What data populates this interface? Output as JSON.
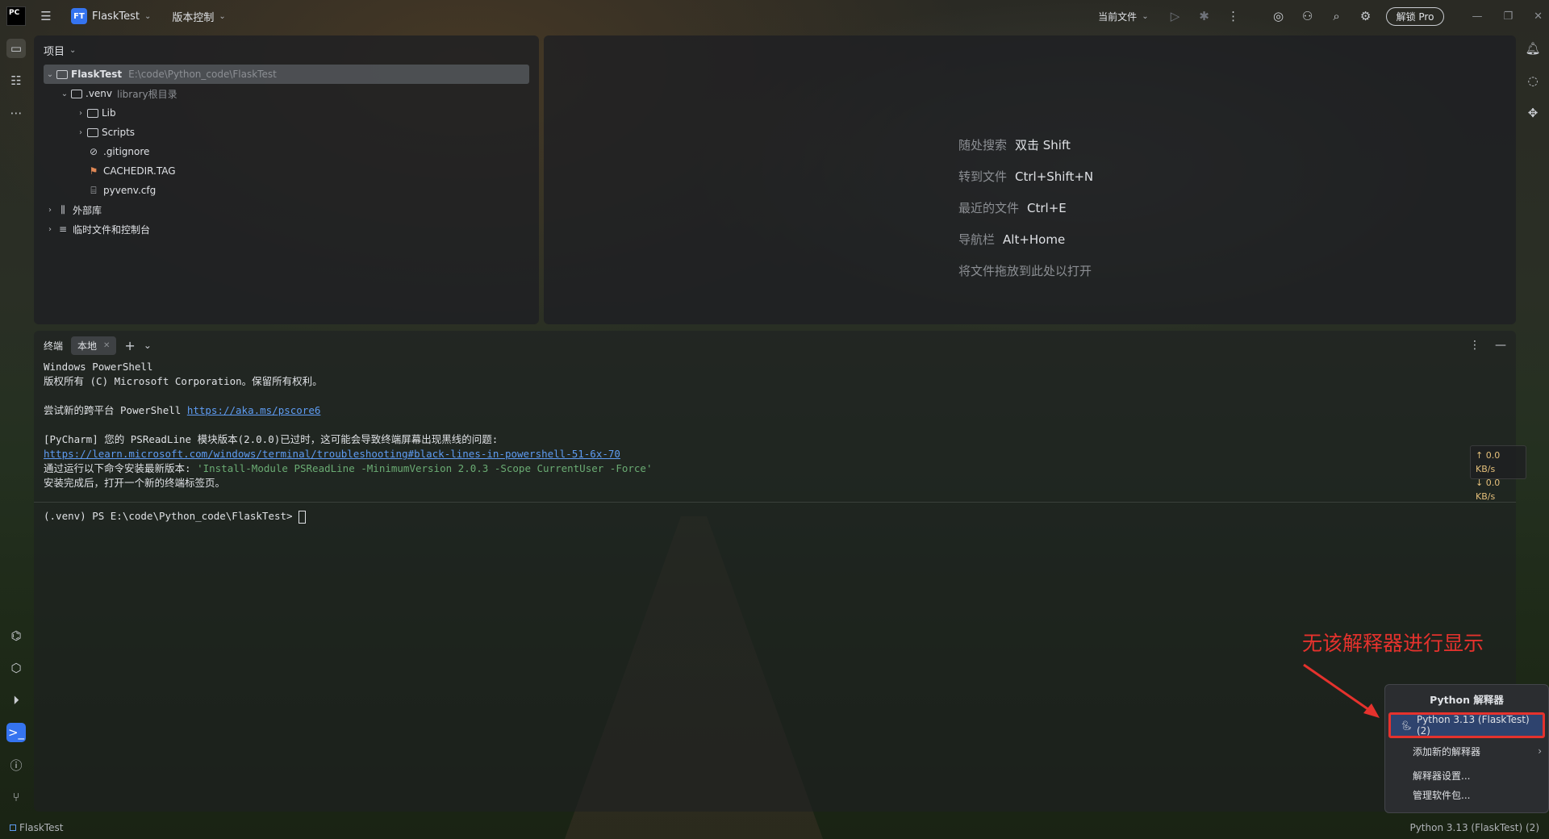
{
  "titlebar": {
    "app_logo": "PC",
    "project_badge": "FT",
    "project_name": "FlaskTest",
    "vcs_label": "版本控制",
    "run_config": "当前文件",
    "unlock_pro": "解锁 Pro"
  },
  "project_panel": {
    "title": "项目",
    "tree": [
      {
        "name": "FlaskTest",
        "hint": "E:\\code\\Python_code\\FlaskTest"
      },
      {
        "name": ".venv",
        "hint": "library根目录"
      },
      {
        "name": "Lib"
      },
      {
        "name": "Scripts"
      },
      {
        "name": ".gitignore"
      },
      {
        "name": "CACHEDIR.TAG"
      },
      {
        "name": "pyvenv.cfg"
      },
      {
        "name": "外部库"
      },
      {
        "name": "临时文件和控制台"
      }
    ]
  },
  "editor": {
    "hints": [
      {
        "label": "随处搜索",
        "key": "双击 Shift"
      },
      {
        "label": "转到文件",
        "key": "Ctrl+Shift+N"
      },
      {
        "label": "最近的文件",
        "key": "Ctrl+E"
      },
      {
        "label": "导航栏",
        "key": "Alt+Home"
      }
    ],
    "drop_hint": "将文件拖放到此处以打开"
  },
  "terminal": {
    "title": "终端",
    "tab": "本地",
    "lines": {
      "l1": "Windows PowerShell",
      "l2": "版权所有 (C) Microsoft Corporation。保留所有权利。",
      "l3_prefix": "尝试新的跨平台 PowerShell ",
      "l3_link": "https://aka.ms/pscore6",
      "l4": "[PyCharm] 您的 PSReadLine 模块版本(2.0.0)已过时，这可能会导致终端屏幕出现黑线的问题:",
      "l5_link": "https://learn.microsoft.com/windows/terminal/troubleshooting#black-lines-in-powershell-51-6x-70",
      "l6_prefix": "通过运行以下命令安装最新版本: ",
      "l6_cmd": "'Install-Module PSReadLine -MinimumVersion 2.0.3 -Scope CurrentUser -Force'",
      "l7": "安装完成后，打开一个新的终端标签页。",
      "prompt": "(.venv) PS E:\\code\\Python_code\\FlaskTest> "
    }
  },
  "net": {
    "up": "↑ 0.0 KB/s",
    "down": "↓ 0.0 KB/s"
  },
  "annotation": "无该解释器进行显示",
  "popup": {
    "title": "Python 解释器",
    "current": "Python 3.13 (FlaskTest) (2)",
    "add": "添加新的解释器",
    "settings": "解释器设置...",
    "packages": "管理软件包..."
  },
  "statusbar": {
    "project": "FlaskTest",
    "interpreter": "Python 3.13 (FlaskTest) (2)"
  },
  "colors": {
    "accent": "#3574f0",
    "annotation": "#e5322d"
  }
}
